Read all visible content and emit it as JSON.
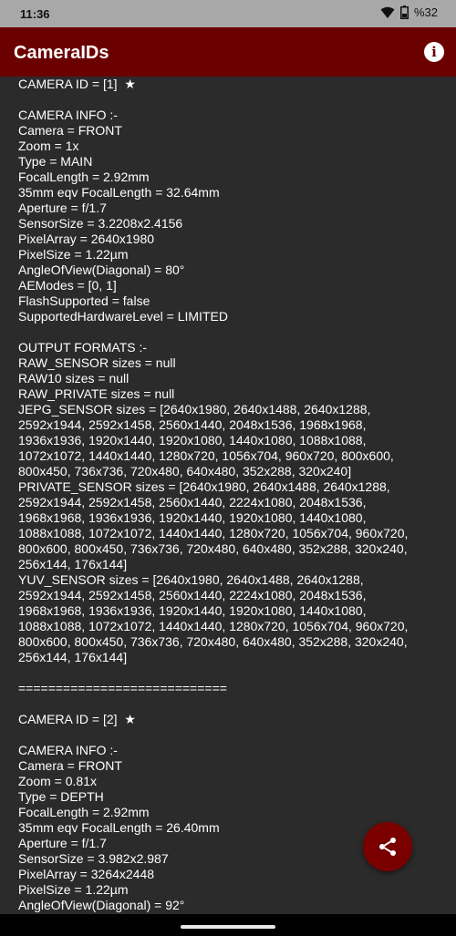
{
  "status": {
    "time": "11:36",
    "battery": "%32"
  },
  "appbar": {
    "title": "CameraIDs"
  },
  "content": {
    "cam1_header": "CAMERA ID = [1]  ★",
    "cam1_info": [
      "CAMERA INFO :-",
      "Camera = FRONT",
      "Zoom = 1x",
      "Type = MAIN",
      "FocalLength = 2.92mm",
      "35mm eqv FocalLength = 32.64mm",
      "Aperture = f/1.7",
      "SensorSize = 3.2208x2.4156",
      "PixelArray = 2640x1980",
      "PixelSize = 1.22µm",
      "AngleOfView(Diagonal) = 80°",
      "AEModes = [0, 1]",
      "FlashSupported = false",
      "SupportedHardwareLevel = LIMITED"
    ],
    "cam1_output": [
      "OUTPUT FORMATS :-",
      "RAW_SENSOR sizes = null",
      "RAW10 sizes = null",
      "RAW_PRIVATE sizes = null",
      "JEPG_SENSOR sizes = [2640x1980, 2640x1488, 2640x1288,",
      "2592x1944, 2592x1458, 2560x1440, 2048x1536, 1968x1968,",
      "1936x1936, 1920x1440, 1920x1080, 1440x1080, 1088x1088,",
      "1072x1072, 1440x1440, 1280x720, 1056x704, 960x720, 800x600,",
      "800x450, 736x736, 720x480, 640x480, 352x288, 320x240]",
      "PRIVATE_SENSOR sizes = [2640x1980, 2640x1488, 2640x1288,",
      "2592x1944, 2592x1458, 2560x1440, 2224x1080, 2048x1536,",
      "1968x1968, 1936x1936, 1920x1440, 1920x1080, 1440x1080,",
      "1088x1088, 1072x1072, 1440x1440, 1280x720, 1056x704, 960x720,",
      "800x600, 800x450, 736x736, 720x480, 640x480, 352x288, 320x240,",
      "256x144, 176x144]",
      "YUV_SENSOR sizes = [2640x1980, 2640x1488, 2640x1288,",
      "2592x1944, 2592x1458, 2560x1440, 2224x1080, 2048x1536,",
      "1968x1968, 1936x1936, 1920x1440, 1920x1080, 1440x1080,",
      "1088x1088, 1072x1072, 1440x1440, 1280x720, 1056x704, 960x720,",
      "800x600, 800x450, 736x736, 720x480, 640x480, 352x288, 320x240,",
      "256x144, 176x144]"
    ],
    "separator": "============================",
    "cam2_header": "CAMERA ID = [2]  ★",
    "cam2_info": [
      "CAMERA INFO :-",
      "Camera = FRONT",
      "Zoom = 0.81x",
      "Type = DEPTH",
      "FocalLength = 2.92mm",
      "35mm eqv FocalLength = 26.40mm",
      "Aperture = f/1.7",
      "SensorSize = 3.982x2.987",
      "PixelArray = 3264x2448",
      "PixelSize = 1.22µm",
      "AngleOfView(Diagonal) = 92°"
    ]
  },
  "colors": {
    "appbar": "#6b0000",
    "fab": "#7a0000",
    "background": "#2b2b2b"
  },
  "icons": {
    "info": "info-icon",
    "share": "share-icon",
    "wifi": "wifi-icon",
    "battery": "battery-icon"
  }
}
